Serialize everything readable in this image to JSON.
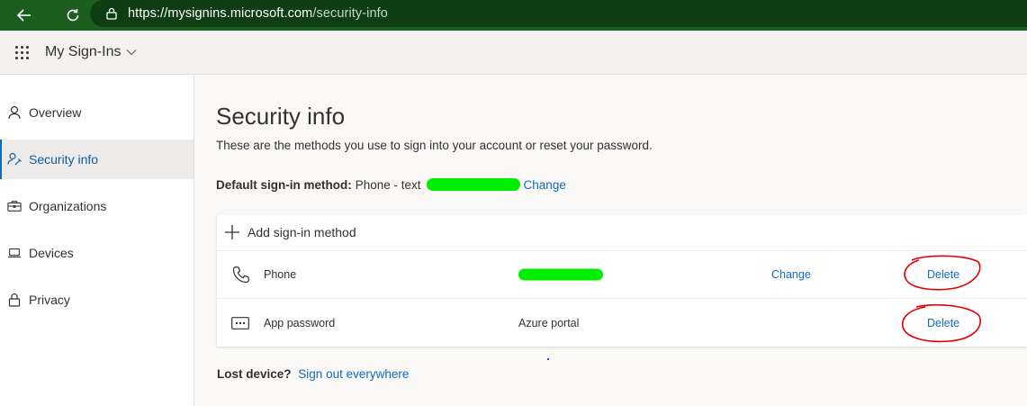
{
  "browser": {
    "url_main": "https://mysignins.microsoft.com",
    "url_path": "/security-info"
  },
  "app": {
    "title": "My Sign-Ins"
  },
  "sidebar": {
    "items": [
      {
        "label": "Overview",
        "icon": "person-icon",
        "active": false
      },
      {
        "label": "Security info",
        "icon": "person-key-icon",
        "active": true
      },
      {
        "label": "Organizations",
        "icon": "briefcase-icon",
        "active": false
      },
      {
        "label": "Devices",
        "icon": "laptop-icon",
        "active": false
      },
      {
        "label": "Privacy",
        "icon": "lock-icon",
        "active": false
      }
    ]
  },
  "main": {
    "title": "Security info",
    "description": "These are the methods you use to sign into your account or reset your password.",
    "default_label": "Default sign-in method:",
    "default_value": "Phone - text",
    "default_change": "Change",
    "add_method": "Add sign-in method",
    "methods": [
      {
        "name": "Phone",
        "icon": "phone-icon",
        "detail": "",
        "detail_redacted": true,
        "change": "Change",
        "delete": "Delete"
      },
      {
        "name": "App password",
        "icon": "password-dots-icon",
        "detail": "Azure portal",
        "detail_redacted": false,
        "change": "",
        "delete": "Delete"
      }
    ],
    "lost_label": "Lost device?",
    "lost_link": "Sign out everywhere"
  },
  "colors": {
    "browser_bar": "#1b5e20",
    "accent_link": "#0f6cbd",
    "redaction": "#00ee00",
    "annotation": "#e00000"
  }
}
